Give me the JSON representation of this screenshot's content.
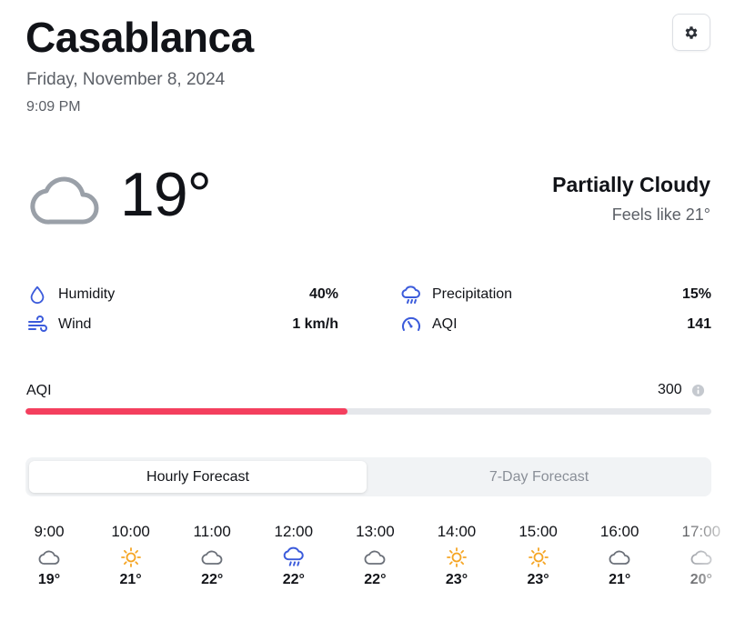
{
  "location": {
    "city": "Casablanca",
    "date": "Friday, November 8, 2024",
    "time": "9:09 PM"
  },
  "current": {
    "icon": "cloud-icon",
    "temperature": "19°",
    "condition": "Partially Cloudy",
    "feels_like": "Feels like 21°"
  },
  "stats": {
    "humidity": {
      "label": "Humidity",
      "value": "40%",
      "icon": "droplet-icon"
    },
    "precipitation": {
      "label": "Precipitation",
      "value": "15%",
      "icon": "cloud-rain-icon"
    },
    "wind": {
      "label": "Wind",
      "value": "1 km/h",
      "icon": "wind-icon"
    },
    "aqi": {
      "label": "AQI",
      "value": "141",
      "icon": "gauge-icon"
    }
  },
  "aqi_bar": {
    "label": "AQI",
    "max_label": "300",
    "current": 141,
    "max": 300,
    "fill_color": "#f43f5e"
  },
  "tabs": [
    {
      "label": "Hourly Forecast",
      "active": true
    },
    {
      "label": "7-Day Forecast",
      "active": false
    }
  ],
  "hourly": [
    {
      "time": "9:00",
      "icon": "cloud-icon",
      "temp": "19°"
    },
    {
      "time": "10:00",
      "icon": "sun-icon",
      "temp": "21°"
    },
    {
      "time": "11:00",
      "icon": "cloud-icon",
      "temp": "22°"
    },
    {
      "time": "12:00",
      "icon": "cloud-rain-icon",
      "temp": "22°"
    },
    {
      "time": "13:00",
      "icon": "cloud-icon",
      "temp": "22°"
    },
    {
      "time": "14:00",
      "icon": "sun-icon",
      "temp": "23°"
    },
    {
      "time": "15:00",
      "icon": "sun-icon",
      "temp": "23°"
    },
    {
      "time": "16:00",
      "icon": "cloud-icon",
      "temp": "21°"
    },
    {
      "time": "17:00",
      "icon": "cloud-icon",
      "temp": "20°"
    }
  ],
  "colors": {
    "accent_blue": "#3b5bdb",
    "sun_yellow": "#f5a524",
    "cloud_gray": "#9aa0a8",
    "aqi_red": "#f43f5e"
  }
}
